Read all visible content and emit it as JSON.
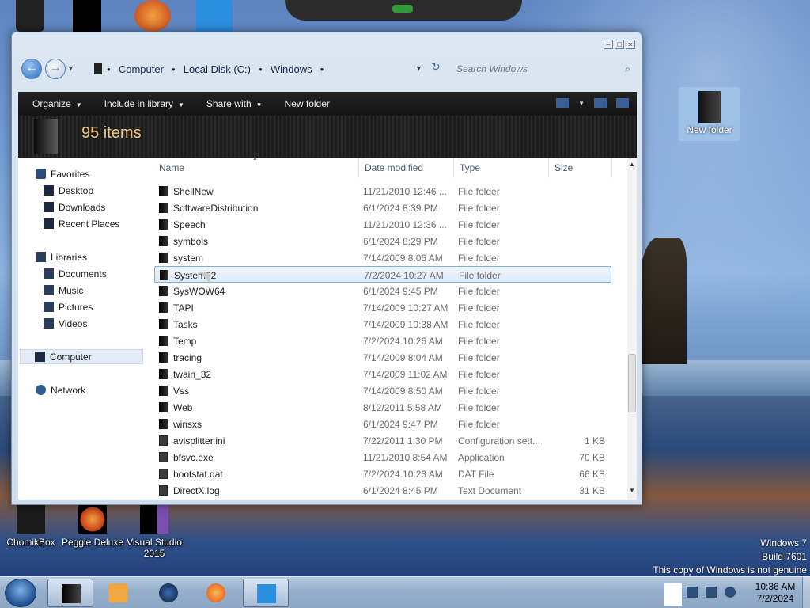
{
  "desktop": {
    "icons": [
      {
        "label": "ChomikBox"
      },
      {
        "label": "Peggle Deluxe"
      },
      {
        "label": "Visual Studio 2015"
      }
    ],
    "new_folder_label": "New folder",
    "watermark": {
      "line1": "Windows 7",
      "line2": "Build 7601",
      "line3": "This copy of Windows is not genuine"
    }
  },
  "window": {
    "address": {
      "crumbs": [
        "Computer",
        "Local Disk (C:)",
        "Windows"
      ]
    },
    "search_placeholder": "Search Windows",
    "toolbar": {
      "organize": "Organize",
      "include_in_library": "Include in library",
      "share_with": "Share with",
      "new_folder": "New folder"
    },
    "item_count": "95 items",
    "nav": {
      "favorites": "Favorites",
      "desktop": "Desktop",
      "downloads": "Downloads",
      "recent_places": "Recent Places",
      "libraries": "Libraries",
      "documents": "Documents",
      "music": "Music",
      "pictures": "Pictures",
      "videos": "Videos",
      "computer": "Computer",
      "network": "Network"
    },
    "columns": {
      "name": "Name",
      "date_modified": "Date modified",
      "type": "Type",
      "size": "Size"
    },
    "files": [
      {
        "name": "ShellNew",
        "date": "11/21/2010 12:46 ...",
        "type": "File folder",
        "size": ""
      },
      {
        "name": "SoftwareDistribution",
        "date": "6/1/2024 8:39 PM",
        "type": "File folder",
        "size": ""
      },
      {
        "name": "Speech",
        "date": "11/21/2010 12:36 ...",
        "type": "File folder",
        "size": ""
      },
      {
        "name": "symbols",
        "date": "6/1/2024 8:29 PM",
        "type": "File folder",
        "size": ""
      },
      {
        "name": "system",
        "date": "7/14/2009 8:06 AM",
        "type": "File folder",
        "size": ""
      },
      {
        "name": "System32",
        "date": "7/2/2024 10:27 AM",
        "type": "File folder",
        "size": ""
      },
      {
        "name": "SysWOW64",
        "date": "6/1/2024 9:45 PM",
        "type": "File folder",
        "size": ""
      },
      {
        "name": "TAPI",
        "date": "7/14/2009 10:27 AM",
        "type": "File folder",
        "size": ""
      },
      {
        "name": "Tasks",
        "date": "7/14/2009 10:38 AM",
        "type": "File folder",
        "size": ""
      },
      {
        "name": "Temp",
        "date": "7/2/2024 10:26 AM",
        "type": "File folder",
        "size": ""
      },
      {
        "name": "tracing",
        "date": "7/14/2009 8:04 AM",
        "type": "File folder",
        "size": ""
      },
      {
        "name": "twain_32",
        "date": "7/14/2009 11:02 AM",
        "type": "File folder",
        "size": ""
      },
      {
        "name": "Vss",
        "date": "7/14/2009 8:50 AM",
        "type": "File folder",
        "size": ""
      },
      {
        "name": "Web",
        "date": "8/12/2011 5:58 AM",
        "type": "File folder",
        "size": ""
      },
      {
        "name": "winsxs",
        "date": "6/1/2024 9:47 PM",
        "type": "File folder",
        "size": ""
      },
      {
        "name": "avisplitter.ini",
        "date": "7/22/2011 1:30 PM",
        "type": "Configuration sett...",
        "size": "1 KB"
      },
      {
        "name": "bfsvc.exe",
        "date": "11/21/2010 8:54 AM",
        "type": "Application",
        "size": "70 KB"
      },
      {
        "name": "bootstat.dat",
        "date": "7/2/2024 10:23 AM",
        "type": "DAT File",
        "size": "66 KB"
      },
      {
        "name": "DirectX.log",
        "date": "6/1/2024 8:45 PM",
        "type": "Text Document",
        "size": "31 KB"
      }
    ]
  },
  "taskbar": {
    "time": "10:36 AM",
    "date": "7/2/2024"
  }
}
